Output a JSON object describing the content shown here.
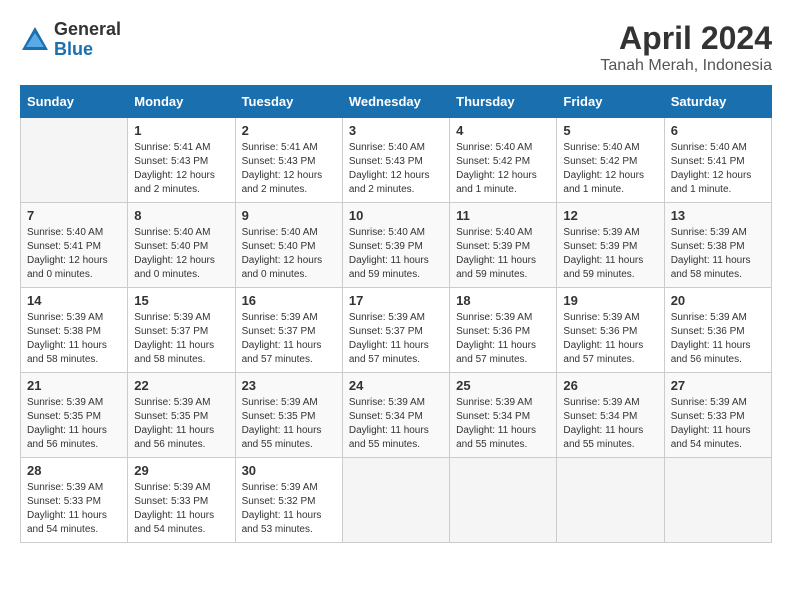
{
  "header": {
    "logo_general": "General",
    "logo_blue": "Blue",
    "month": "April 2024",
    "location": "Tanah Merah, Indonesia"
  },
  "days_of_week": [
    "Sunday",
    "Monday",
    "Tuesday",
    "Wednesday",
    "Thursday",
    "Friday",
    "Saturday"
  ],
  "weeks": [
    [
      {
        "day": "",
        "info": ""
      },
      {
        "day": "1",
        "info": "Sunrise: 5:41 AM\nSunset: 5:43 PM\nDaylight: 12 hours\nand 2 minutes."
      },
      {
        "day": "2",
        "info": "Sunrise: 5:41 AM\nSunset: 5:43 PM\nDaylight: 12 hours\nand 2 minutes."
      },
      {
        "day": "3",
        "info": "Sunrise: 5:40 AM\nSunset: 5:43 PM\nDaylight: 12 hours\nand 2 minutes."
      },
      {
        "day": "4",
        "info": "Sunrise: 5:40 AM\nSunset: 5:42 PM\nDaylight: 12 hours\nand 1 minute."
      },
      {
        "day": "5",
        "info": "Sunrise: 5:40 AM\nSunset: 5:42 PM\nDaylight: 12 hours\nand 1 minute."
      },
      {
        "day": "6",
        "info": "Sunrise: 5:40 AM\nSunset: 5:41 PM\nDaylight: 12 hours\nand 1 minute."
      }
    ],
    [
      {
        "day": "7",
        "info": "Sunrise: 5:40 AM\nSunset: 5:41 PM\nDaylight: 12 hours\nand 0 minutes."
      },
      {
        "day": "8",
        "info": "Sunrise: 5:40 AM\nSunset: 5:40 PM\nDaylight: 12 hours\nand 0 minutes."
      },
      {
        "day": "9",
        "info": "Sunrise: 5:40 AM\nSunset: 5:40 PM\nDaylight: 12 hours\nand 0 minutes."
      },
      {
        "day": "10",
        "info": "Sunrise: 5:40 AM\nSunset: 5:39 PM\nDaylight: 11 hours\nand 59 minutes."
      },
      {
        "day": "11",
        "info": "Sunrise: 5:40 AM\nSunset: 5:39 PM\nDaylight: 11 hours\nand 59 minutes."
      },
      {
        "day": "12",
        "info": "Sunrise: 5:39 AM\nSunset: 5:39 PM\nDaylight: 11 hours\nand 59 minutes."
      },
      {
        "day": "13",
        "info": "Sunrise: 5:39 AM\nSunset: 5:38 PM\nDaylight: 11 hours\nand 58 minutes."
      }
    ],
    [
      {
        "day": "14",
        "info": "Sunrise: 5:39 AM\nSunset: 5:38 PM\nDaylight: 11 hours\nand 58 minutes."
      },
      {
        "day": "15",
        "info": "Sunrise: 5:39 AM\nSunset: 5:37 PM\nDaylight: 11 hours\nand 58 minutes."
      },
      {
        "day": "16",
        "info": "Sunrise: 5:39 AM\nSunset: 5:37 PM\nDaylight: 11 hours\nand 57 minutes."
      },
      {
        "day": "17",
        "info": "Sunrise: 5:39 AM\nSunset: 5:37 PM\nDaylight: 11 hours\nand 57 minutes."
      },
      {
        "day": "18",
        "info": "Sunrise: 5:39 AM\nSunset: 5:36 PM\nDaylight: 11 hours\nand 57 minutes."
      },
      {
        "day": "19",
        "info": "Sunrise: 5:39 AM\nSunset: 5:36 PM\nDaylight: 11 hours\nand 57 minutes."
      },
      {
        "day": "20",
        "info": "Sunrise: 5:39 AM\nSunset: 5:36 PM\nDaylight: 11 hours\nand 56 minutes."
      }
    ],
    [
      {
        "day": "21",
        "info": "Sunrise: 5:39 AM\nSunset: 5:35 PM\nDaylight: 11 hours\nand 56 minutes."
      },
      {
        "day": "22",
        "info": "Sunrise: 5:39 AM\nSunset: 5:35 PM\nDaylight: 11 hours\nand 56 minutes."
      },
      {
        "day": "23",
        "info": "Sunrise: 5:39 AM\nSunset: 5:35 PM\nDaylight: 11 hours\nand 55 minutes."
      },
      {
        "day": "24",
        "info": "Sunrise: 5:39 AM\nSunset: 5:34 PM\nDaylight: 11 hours\nand 55 minutes."
      },
      {
        "day": "25",
        "info": "Sunrise: 5:39 AM\nSunset: 5:34 PM\nDaylight: 11 hours\nand 55 minutes."
      },
      {
        "day": "26",
        "info": "Sunrise: 5:39 AM\nSunset: 5:34 PM\nDaylight: 11 hours\nand 55 minutes."
      },
      {
        "day": "27",
        "info": "Sunrise: 5:39 AM\nSunset: 5:33 PM\nDaylight: 11 hours\nand 54 minutes."
      }
    ],
    [
      {
        "day": "28",
        "info": "Sunrise: 5:39 AM\nSunset: 5:33 PM\nDaylight: 11 hours\nand 54 minutes."
      },
      {
        "day": "29",
        "info": "Sunrise: 5:39 AM\nSunset: 5:33 PM\nDaylight: 11 hours\nand 54 minutes."
      },
      {
        "day": "30",
        "info": "Sunrise: 5:39 AM\nSunset: 5:32 PM\nDaylight: 11 hours\nand 53 minutes."
      },
      {
        "day": "",
        "info": ""
      },
      {
        "day": "",
        "info": ""
      },
      {
        "day": "",
        "info": ""
      },
      {
        "day": "",
        "info": ""
      }
    ]
  ]
}
